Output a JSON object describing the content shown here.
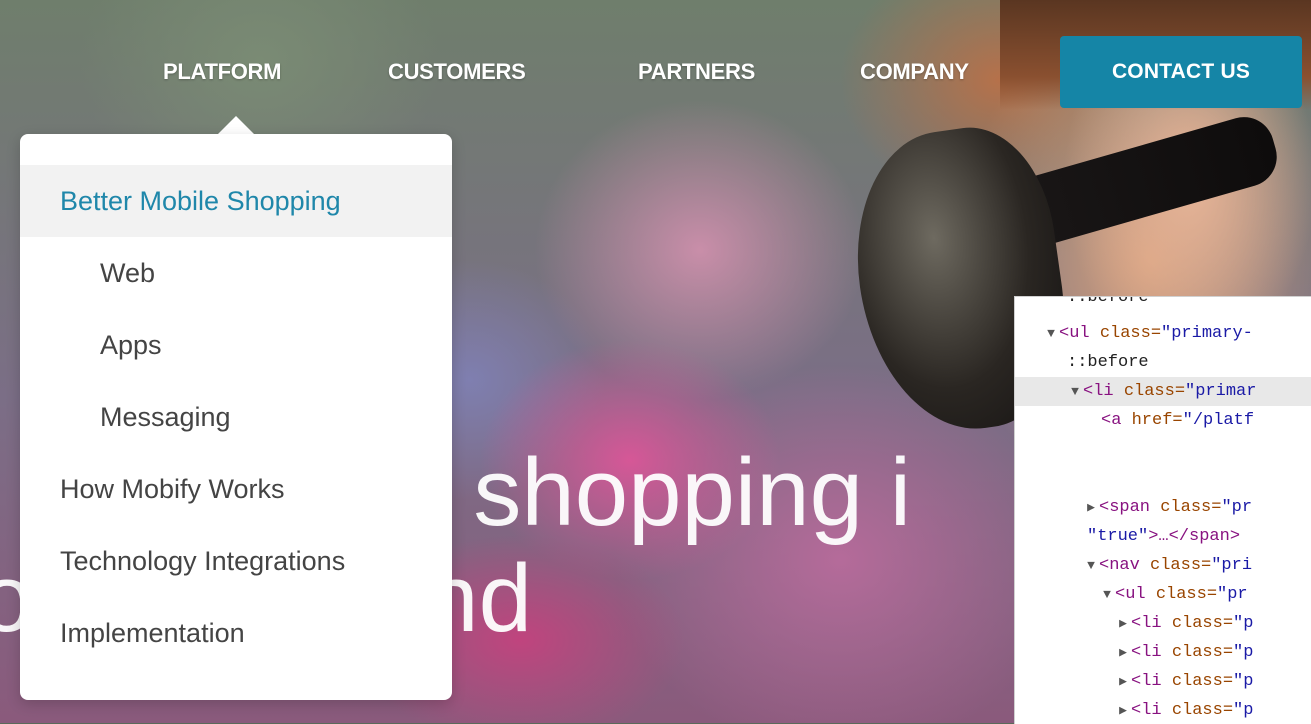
{
  "nav": {
    "platform": "PLATFORM",
    "customers": "CUSTOMERS",
    "partners": "PARTNERS",
    "company": "COMPANY",
    "contact": "CONTACT US"
  },
  "dropdown": {
    "items": [
      {
        "label": "Better Mobile Shopping"
      },
      {
        "label": "Web"
      },
      {
        "label": "Apps"
      },
      {
        "label": "Messaging"
      },
      {
        "label": "How Mobify Works"
      },
      {
        "label": "Technology Integrations"
      },
      {
        "label": "Implementation"
      }
    ]
  },
  "hero": {
    "line1": "f shopping i",
    "line2": "o mers' hand"
  },
  "devtools": {
    "lines": [
      {
        "text": "::before"
      },
      {
        "tri": "▼",
        "tag_open": "<ul ",
        "attr": "class=",
        "val": "\"primary-"
      },
      {
        "text": "::before"
      },
      {
        "tri": "▼",
        "tag_open": "<li ",
        "attr": "class=",
        "val": "\"primar"
      },
      {
        "tag_open": "<a ",
        "attr": "href=",
        "val": "\"/platf"
      },
      {
        "tri": "▶",
        "tag_open": "<span ",
        "attr": "class=",
        "val": "\"pr"
      },
      {
        "val": "\"true\"",
        "tag_close": ">…</span>"
      },
      {
        "tri": "▼",
        "tag_open": "<nav ",
        "attr": "class=",
        "val": "\"pri"
      },
      {
        "tri": "▼",
        "tag_open": "<ul ",
        "attr": "class=",
        "val": "\"pr"
      },
      {
        "tri": "▶",
        "tag_open": "<li ",
        "attr": "class=",
        "val": "\"p"
      },
      {
        "tri": "▶",
        "tag_open": "<li ",
        "attr": "class=",
        "val": "\"p"
      },
      {
        "tri": "▶",
        "tag_open": "<li ",
        "attr": "class=",
        "val": "\"p"
      },
      {
        "tri": "▶",
        "tag_open": "<li ",
        "attr": "class=",
        "val": "\"p"
      }
    ]
  },
  "colors": {
    "accent": "#1585a6",
    "active_link": "#1f87aa"
  }
}
